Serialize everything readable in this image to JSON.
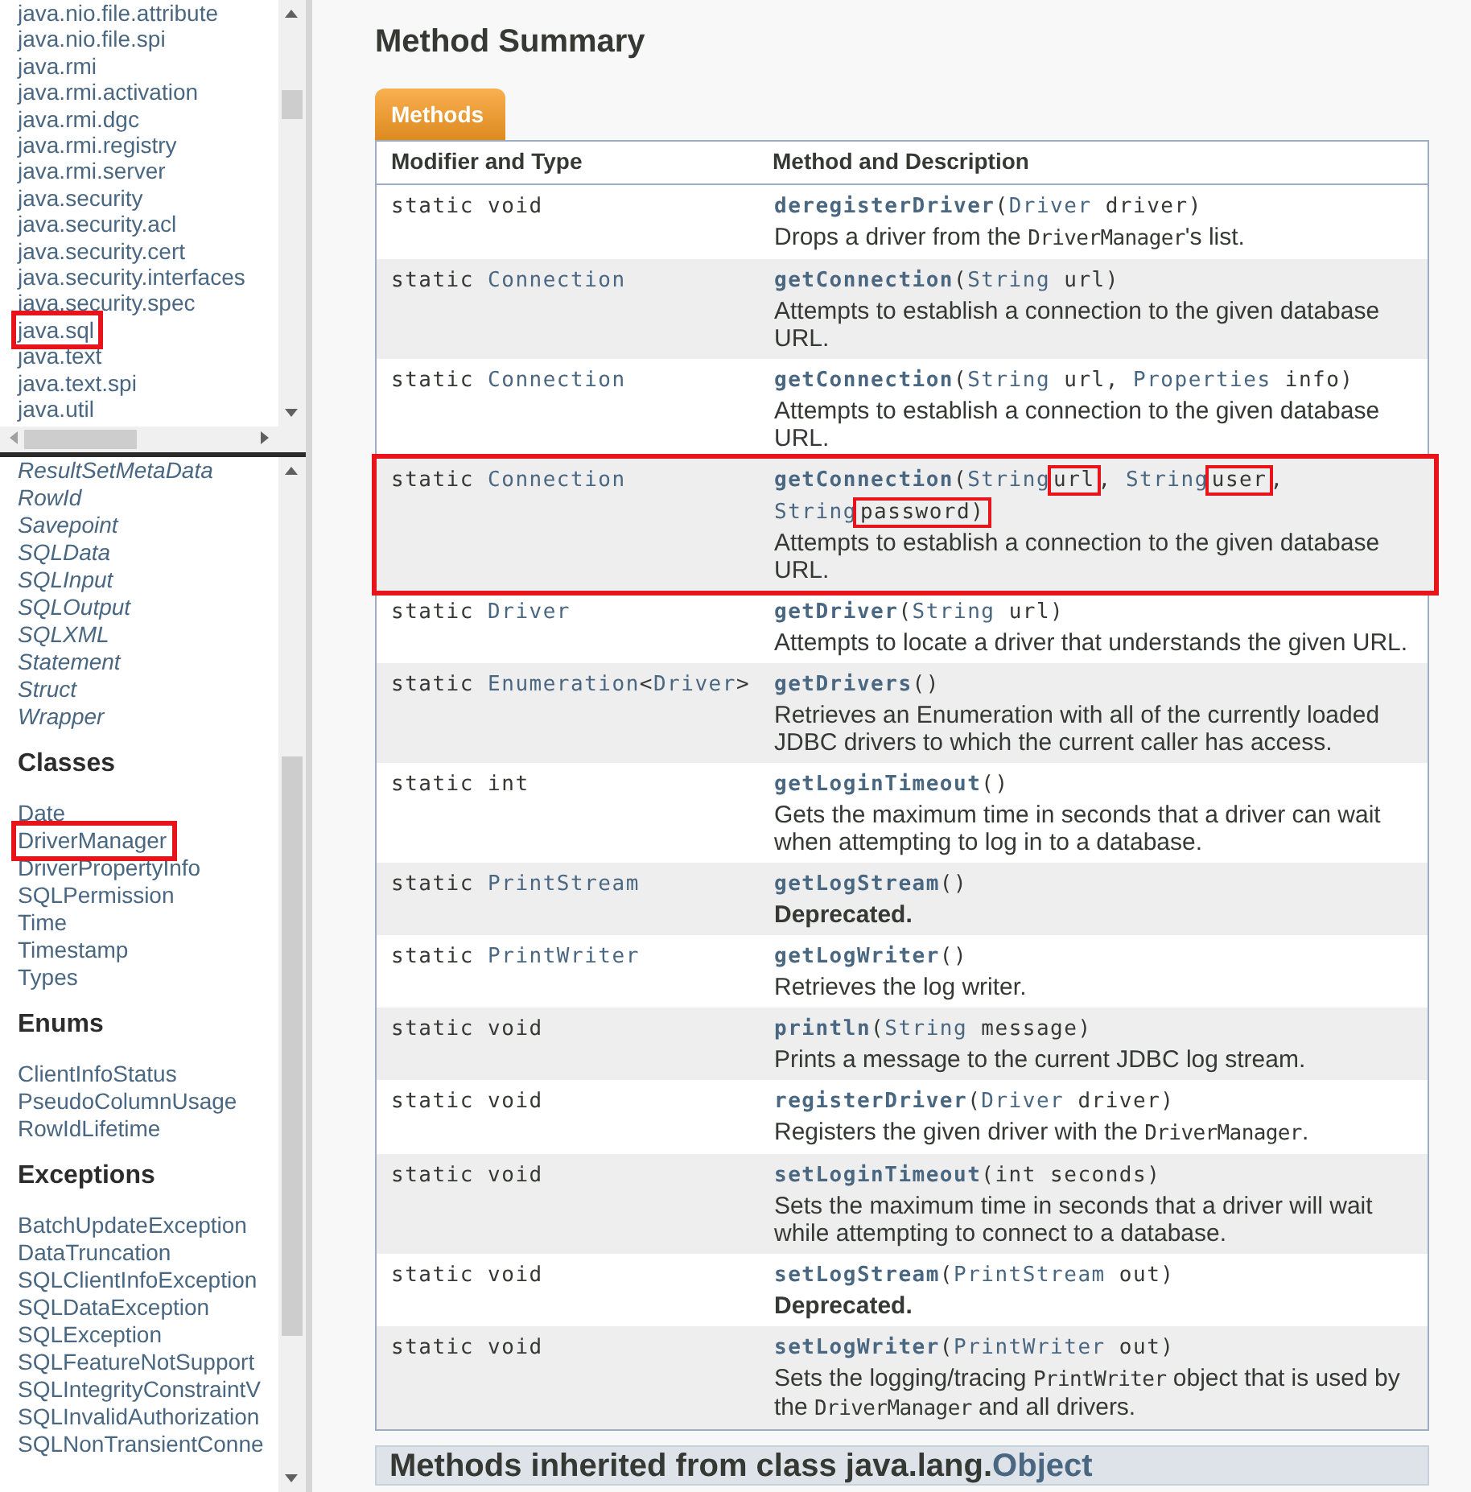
{
  "package_frame": {
    "items": [
      {
        "label": "java.nio.file.attribute",
        "highlighted": false
      },
      {
        "label": "java.nio.file.spi",
        "highlighted": false
      },
      {
        "label": "java.rmi",
        "highlighted": false
      },
      {
        "label": "java.rmi.activation",
        "highlighted": false
      },
      {
        "label": "java.rmi.dgc",
        "highlighted": false
      },
      {
        "label": "java.rmi.registry",
        "highlighted": false
      },
      {
        "label": "java.rmi.server",
        "highlighted": false
      },
      {
        "label": "java.security",
        "highlighted": false
      },
      {
        "label": "java.security.acl",
        "highlighted": false
      },
      {
        "label": "java.security.cert",
        "highlighted": false
      },
      {
        "label": "java.security.interfaces",
        "highlighted": false
      },
      {
        "label": "java.security.spec",
        "highlighted": false
      },
      {
        "label": "java.sql",
        "highlighted": true
      },
      {
        "label": "java.text",
        "highlighted": false
      },
      {
        "label": "java.text.spi",
        "highlighted": false
      },
      {
        "label": "java.util",
        "highlighted": false
      }
    ]
  },
  "class_frame": {
    "sections": [
      {
        "kind": "interfaces",
        "items": [
          {
            "label": "ResultSetMetaData",
            "highlighted": false
          },
          {
            "label": "RowId",
            "highlighted": false
          },
          {
            "label": "Savepoint",
            "highlighted": false
          },
          {
            "label": "SQLData",
            "highlighted": false
          },
          {
            "label": "SQLInput",
            "highlighted": false
          },
          {
            "label": "SQLOutput",
            "highlighted": false
          },
          {
            "label": "SQLXML",
            "highlighted": false
          },
          {
            "label": "Statement",
            "highlighted": false
          },
          {
            "label": "Struct",
            "highlighted": false
          },
          {
            "label": "Wrapper",
            "highlighted": false
          }
        ]
      },
      {
        "kind": "classes",
        "heading": "Classes",
        "items": [
          {
            "label": "Date",
            "highlighted": false
          },
          {
            "label": "DriverManager",
            "highlighted": true
          },
          {
            "label": "DriverPropertyInfo",
            "highlighted": false
          },
          {
            "label": "SQLPermission",
            "highlighted": false
          },
          {
            "label": "Time",
            "highlighted": false
          },
          {
            "label": "Timestamp",
            "highlighted": false
          },
          {
            "label": "Types",
            "highlighted": false
          }
        ]
      },
      {
        "kind": "classes",
        "heading": "Enums",
        "items": [
          {
            "label": "ClientInfoStatus",
            "highlighted": false
          },
          {
            "label": "PseudoColumnUsage",
            "highlighted": false
          },
          {
            "label": "RowIdLifetime",
            "highlighted": false
          }
        ]
      },
      {
        "kind": "classes",
        "heading": "Exceptions",
        "items": [
          {
            "label": "BatchUpdateException",
            "highlighted": false
          },
          {
            "label": "DataTruncation",
            "highlighted": false
          },
          {
            "label": "SQLClientInfoException",
            "highlighted": false
          },
          {
            "label": "SQLDataException",
            "highlighted": false
          },
          {
            "label": "SQLException",
            "highlighted": false
          },
          {
            "label": "SQLFeatureNotSupport",
            "highlighted": false
          },
          {
            "label": "SQLIntegrityConstraintV",
            "highlighted": false
          },
          {
            "label": "SQLInvalidAuthorization",
            "highlighted": false
          },
          {
            "label": "SQLNonTransientConne",
            "highlighted": false
          }
        ]
      }
    ]
  },
  "method_summary": {
    "title": "Method Summary",
    "caption": "Methods",
    "columns": [
      "Modifier and Type",
      "Method and Description"
    ],
    "rows": [
      {
        "highlighted": false,
        "modifier": [
          {
            "kind": "text",
            "text": "static void"
          }
        ],
        "signature": [
          {
            "kind": "method",
            "text": "deregisterDriver"
          },
          {
            "kind": "text",
            "text": "("
          },
          {
            "kind": "type",
            "text": "Driver"
          },
          {
            "kind": "text",
            "text": " driver)"
          }
        ],
        "description": [
          {
            "kind": "text",
            "text": "Drops a driver from the "
          },
          {
            "kind": "code",
            "text": "DriverManager"
          },
          {
            "kind": "text",
            "text": "'s list."
          }
        ]
      },
      {
        "highlighted": false,
        "modifier": [
          {
            "kind": "text",
            "text": "static "
          },
          {
            "kind": "type",
            "text": "Connection"
          }
        ],
        "signature": [
          {
            "kind": "method",
            "text": "getConnection"
          },
          {
            "kind": "text",
            "text": "("
          },
          {
            "kind": "type",
            "text": "String"
          },
          {
            "kind": "text",
            "text": " url)"
          }
        ],
        "description": [
          {
            "kind": "text",
            "text": "Attempts to establish a connection to the given database URL."
          }
        ]
      },
      {
        "highlighted": false,
        "modifier": [
          {
            "kind": "text",
            "text": "static "
          },
          {
            "kind": "type",
            "text": "Connection"
          }
        ],
        "signature": [
          {
            "kind": "method",
            "text": "getConnection"
          },
          {
            "kind": "text",
            "text": "("
          },
          {
            "kind": "type",
            "text": "String"
          },
          {
            "kind": "text",
            "text": " url, "
          },
          {
            "kind": "type",
            "text": "Properties"
          },
          {
            "kind": "text",
            "text": " info)"
          }
        ],
        "description": [
          {
            "kind": "text",
            "text": "Attempts to establish a connection to the given database URL."
          }
        ]
      },
      {
        "highlighted": true,
        "modifier": [
          {
            "kind": "text",
            "text": "static "
          },
          {
            "kind": "type",
            "text": "Connection"
          }
        ],
        "signature": [
          {
            "kind": "method",
            "text": "getConnection"
          },
          {
            "kind": "text",
            "text": "("
          },
          {
            "kind": "type",
            "text": "String"
          },
          {
            "kind": "marked",
            "text": "url"
          },
          {
            "kind": "text",
            "text": ", "
          },
          {
            "kind": "type",
            "text": "String"
          },
          {
            "kind": "marked",
            "text": "user"
          },
          {
            "kind": "text",
            "text": ", "
          },
          {
            "kind": "type",
            "text": "String"
          },
          {
            "kind": "marked",
            "text": "password)"
          }
        ],
        "description": [
          {
            "kind": "text",
            "text": "Attempts to establish a connection to the given database URL."
          }
        ]
      },
      {
        "highlighted": false,
        "modifier": [
          {
            "kind": "text",
            "text": "static "
          },
          {
            "kind": "type",
            "text": "Driver"
          }
        ],
        "signature": [
          {
            "kind": "method",
            "text": "getDriver"
          },
          {
            "kind": "text",
            "text": "("
          },
          {
            "kind": "type",
            "text": "String"
          },
          {
            "kind": "text",
            "text": " url)"
          }
        ],
        "description": [
          {
            "kind": "text",
            "text": "Attempts to locate a driver that understands the given URL."
          }
        ]
      },
      {
        "highlighted": false,
        "modifier": [
          {
            "kind": "text",
            "text": "static "
          },
          {
            "kind": "type",
            "text": "Enumeration"
          },
          {
            "kind": "text",
            "text": "<"
          },
          {
            "kind": "type",
            "text": "Driver"
          },
          {
            "kind": "text",
            "text": ">"
          }
        ],
        "signature": [
          {
            "kind": "method",
            "text": "getDrivers"
          },
          {
            "kind": "text",
            "text": "()"
          }
        ],
        "description": [
          {
            "kind": "text",
            "text": "Retrieves an Enumeration with all of the currently loaded JDBC drivers to which the current caller has access."
          }
        ]
      },
      {
        "highlighted": false,
        "modifier": [
          {
            "kind": "text",
            "text": "static int"
          }
        ],
        "signature": [
          {
            "kind": "method",
            "text": "getLoginTimeout"
          },
          {
            "kind": "text",
            "text": "()"
          }
        ],
        "description": [
          {
            "kind": "text",
            "text": "Gets the maximum time in seconds that a driver can wait when attempting to log in to a database."
          }
        ]
      },
      {
        "highlighted": false,
        "modifier": [
          {
            "kind": "text",
            "text": "static "
          },
          {
            "kind": "type",
            "text": "PrintStream"
          }
        ],
        "signature": [
          {
            "kind": "method",
            "text": "getLogStream"
          },
          {
            "kind": "text",
            "text": "()"
          }
        ],
        "description": [
          {
            "kind": "bold",
            "text": "Deprecated."
          }
        ]
      },
      {
        "highlighted": false,
        "modifier": [
          {
            "kind": "text",
            "text": "static "
          },
          {
            "kind": "type",
            "text": "PrintWriter"
          }
        ],
        "signature": [
          {
            "kind": "method",
            "text": "getLogWriter"
          },
          {
            "kind": "text",
            "text": "()"
          }
        ],
        "description": [
          {
            "kind": "text",
            "text": "Retrieves the log writer."
          }
        ]
      },
      {
        "highlighted": false,
        "modifier": [
          {
            "kind": "text",
            "text": "static void"
          }
        ],
        "signature": [
          {
            "kind": "method",
            "text": "println"
          },
          {
            "kind": "text",
            "text": "("
          },
          {
            "kind": "type",
            "text": "String"
          },
          {
            "kind": "text",
            "text": " message)"
          }
        ],
        "description": [
          {
            "kind": "text",
            "text": "Prints a message to the current JDBC log stream."
          }
        ]
      },
      {
        "highlighted": false,
        "modifier": [
          {
            "kind": "text",
            "text": "static void"
          }
        ],
        "signature": [
          {
            "kind": "method",
            "text": "registerDriver"
          },
          {
            "kind": "text",
            "text": "("
          },
          {
            "kind": "type",
            "text": "Driver"
          },
          {
            "kind": "text",
            "text": " driver)"
          }
        ],
        "description": [
          {
            "kind": "text",
            "text": "Registers the given driver with the "
          },
          {
            "kind": "code",
            "text": "DriverManager"
          },
          {
            "kind": "text",
            "text": "."
          }
        ]
      },
      {
        "highlighted": false,
        "modifier": [
          {
            "kind": "text",
            "text": "static void"
          }
        ],
        "signature": [
          {
            "kind": "method",
            "text": "setLoginTimeout"
          },
          {
            "kind": "text",
            "text": "(int seconds)"
          }
        ],
        "description": [
          {
            "kind": "text",
            "text": "Sets the maximum time in seconds that a driver will wait while attempting to connect to a database."
          }
        ]
      },
      {
        "highlighted": false,
        "modifier": [
          {
            "kind": "text",
            "text": "static void"
          }
        ],
        "signature": [
          {
            "kind": "method",
            "text": "setLogStream"
          },
          {
            "kind": "text",
            "text": "("
          },
          {
            "kind": "type",
            "text": "PrintStream"
          },
          {
            "kind": "text",
            "text": " out)"
          }
        ],
        "description": [
          {
            "kind": "bold",
            "text": "Deprecated."
          }
        ]
      },
      {
        "highlighted": false,
        "modifier": [
          {
            "kind": "text",
            "text": "static void"
          }
        ],
        "signature": [
          {
            "kind": "method",
            "text": "setLogWriter"
          },
          {
            "kind": "text",
            "text": "("
          },
          {
            "kind": "type",
            "text": "PrintWriter"
          },
          {
            "kind": "text",
            "text": " out)"
          }
        ],
        "description": [
          {
            "kind": "text",
            "text": "Sets the logging/tracing "
          },
          {
            "kind": "code",
            "text": "PrintWriter"
          },
          {
            "kind": "text",
            "text": " object that is used by the "
          },
          {
            "kind": "code",
            "text": "DriverManager"
          },
          {
            "kind": "text",
            "text": " and all drivers."
          }
        ]
      }
    ]
  },
  "inherited": {
    "title": [
      {
        "kind": "text",
        "text": "Methods inherited from class java.lang."
      },
      {
        "kind": "link",
        "text": "Object"
      }
    ]
  }
}
